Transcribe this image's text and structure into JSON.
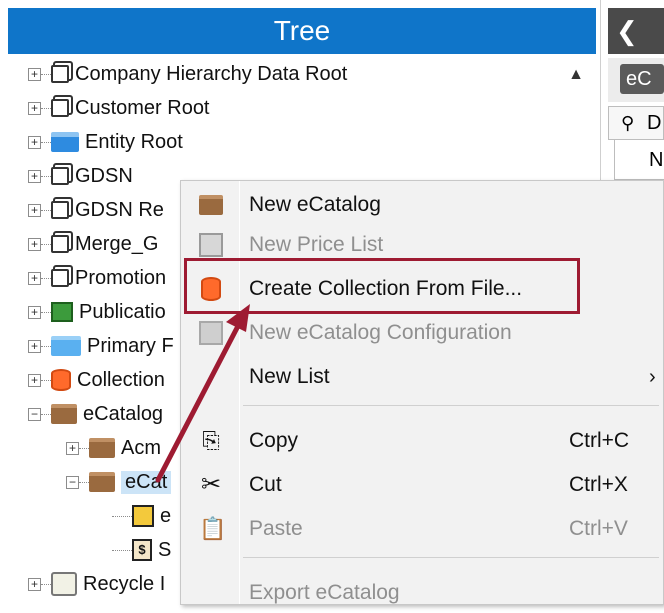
{
  "tree": {
    "title": "Tree",
    "nodes": [
      {
        "label": "Company Hierarchy Data Root",
        "icon": "page-icon",
        "expander": "+"
      },
      {
        "label": "Customer Root",
        "icon": "page-icon",
        "expander": "+"
      },
      {
        "label": "Entity Root",
        "icon": "entity-folder-icon",
        "expander": "+"
      },
      {
        "label": "GDSN",
        "icon": "page-icon",
        "expander": "+"
      },
      {
        "label": "GDSN Re",
        "icon": "page-icon",
        "expander": "+"
      },
      {
        "label": "Merge_G",
        "icon": "page-icon",
        "expander": "+"
      },
      {
        "label": "Promotion",
        "icon": "page-icon",
        "expander": "+"
      },
      {
        "label": "Publicatio",
        "icon": "publication-icon",
        "expander": "+"
      },
      {
        "label": "Primary F",
        "icon": "folder-icon",
        "expander": "+"
      },
      {
        "label": "Collection",
        "icon": "collection-icon",
        "expander": "+"
      },
      {
        "label": "eCatalog",
        "icon": "ecatalog-folder-icon",
        "expander": "−"
      },
      {
        "label": "Acm",
        "icon": "ecatalog-folder-icon",
        "expander": "+"
      },
      {
        "label": "eCat",
        "icon": "ecatalog-folder-icon",
        "expander": "−"
      },
      {
        "label": "e",
        "icon": "configuration-icon",
        "expander": ""
      },
      {
        "label": "S",
        "icon": "price-list-icon",
        "expander": ""
      },
      {
        "label": "Recycle I",
        "icon": "recycle-bin-icon",
        "expander": "+"
      }
    ]
  },
  "right_panel": {
    "back_glyph": "❮",
    "tab_label": "eC",
    "grid_header": "D",
    "grid_row_text": "N"
  },
  "context_menu": {
    "items": [
      {
        "label": "New eCatalog",
        "enabled": true,
        "icon": "ecatalog-folder-icon"
      },
      {
        "label": "New Price List",
        "enabled": false,
        "icon": "price-list-icon"
      },
      {
        "label": "Create Collection From File...",
        "enabled": true,
        "icon": "collection-icon",
        "highlighted": true
      },
      {
        "label": "New eCatalog Configuration",
        "enabled": false,
        "icon": "configuration-icon"
      },
      {
        "label": "New List",
        "enabled": true,
        "submenu_arrow": "›"
      },
      {
        "label": "Copy",
        "enabled": true,
        "shortcut": "Ctrl+C",
        "icon": "copy-icon"
      },
      {
        "label": "Cut",
        "enabled": true,
        "shortcut": "Ctrl+X",
        "icon": "cut-icon"
      },
      {
        "label": "Paste",
        "enabled": false,
        "shortcut": "Ctrl+V",
        "icon": "paste-icon"
      },
      {
        "label": "Export eCatalog",
        "enabled": false
      }
    ]
  },
  "colors": {
    "header_blue": "#0f75c9",
    "annotation_red": "#9e1b32",
    "selection_blue": "#cce4f7"
  }
}
